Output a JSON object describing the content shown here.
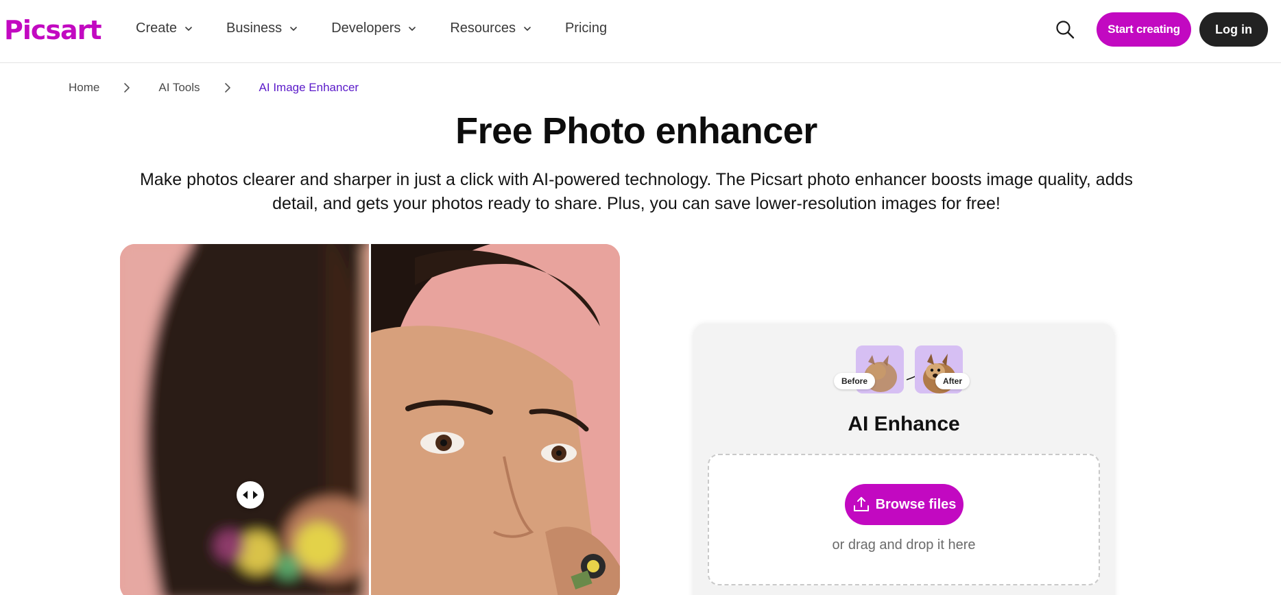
{
  "header": {
    "logo": "Picsart",
    "nav": [
      {
        "label": "Create",
        "has_dropdown": true
      },
      {
        "label": "Business",
        "has_dropdown": true
      },
      {
        "label": "Developers",
        "has_dropdown": true
      },
      {
        "label": "Resources",
        "has_dropdown": true
      },
      {
        "label": "Pricing",
        "has_dropdown": false
      }
    ],
    "search_icon": "search-icon",
    "start_label": "Start creating",
    "login_label": "Log in",
    "accent": "#c209c1",
    "dark": "#222222"
  },
  "breadcrumb": {
    "items": [
      "Home",
      "AI Tools",
      "AI Image Enhancer"
    ],
    "current_color": "#5a19c9"
  },
  "hero": {
    "title": "Free Photo enhancer",
    "description": "Make photos clearer and sharper in just a click with AI-powered technology. The Picsart photo enhancer boosts image quality, adds detail, and gets your photos ready to share. Plus, you can save lower-resolution images for free!"
  },
  "compare": {
    "before_side": "left",
    "after_side": "right",
    "handle_icon": "compare-arrows-icon"
  },
  "upload_card": {
    "before_tag": "Before",
    "after_tag": "After",
    "title": "AI Enhance",
    "browse_label": "Browse files",
    "upload_icon": "upload-icon",
    "drop_hint": "or drag and drop it here"
  }
}
